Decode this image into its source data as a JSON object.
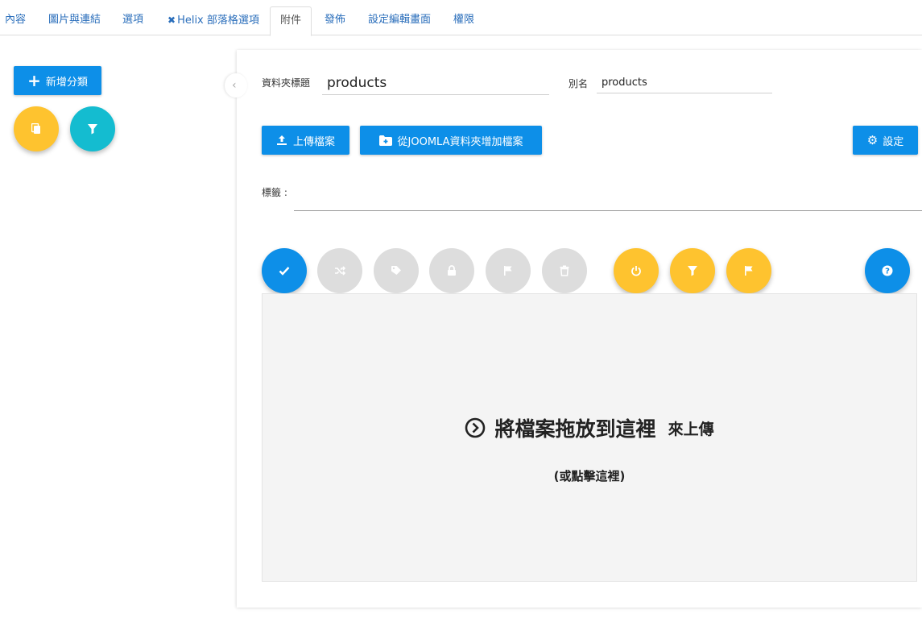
{
  "tabs": [
    {
      "label": "內容"
    },
    {
      "label": "圖片與連結"
    },
    {
      "label": "選項"
    },
    {
      "label": "Helix 部落格選項",
      "icon": "joomla-icon"
    },
    {
      "label": "附件",
      "active": true
    },
    {
      "label": "發佈"
    },
    {
      "label": "設定編輯畫面"
    },
    {
      "label": "權限"
    }
  ],
  "sidebar": {
    "add_category_label": "新增分類",
    "copy_icon": "copy-icon",
    "filter_icon": "filter-icon"
  },
  "folder": {
    "title_label": "資料夾標題",
    "title_value": "products",
    "alias_label": "別名",
    "alias_value": "products"
  },
  "toolbar": {
    "upload_label": "上傳檔案",
    "add_from_joomla_label": "從JOOMLA資料夾增加檔案",
    "settings_label": "設定"
  },
  "tags": {
    "label": "標籤 :"
  },
  "actions": [
    {
      "icon": "check-icon",
      "style": "blue"
    },
    {
      "icon": "shuffle-icon",
      "style": "grey"
    },
    {
      "icon": "tag-icon",
      "style": "grey"
    },
    {
      "icon": "lock-icon",
      "style": "grey"
    },
    {
      "icon": "flag-icon",
      "style": "grey"
    },
    {
      "icon": "trash-icon",
      "style": "grey"
    },
    {
      "icon": "power-icon",
      "style": "yellow"
    },
    {
      "icon": "filter-icon",
      "style": "yellow"
    },
    {
      "icon": "flag-icon",
      "style": "yellow"
    },
    {
      "icon": "help-icon",
      "style": "blue"
    }
  ],
  "dropzone": {
    "main": "將檔案拖放到這裡",
    "suffix": "來上傳",
    "sub": "(或點擊這裡)"
  },
  "colors": {
    "primary": "#0d8fe8",
    "yellow": "#fec32f",
    "teal": "#14bcd0",
    "grey": "#dddddd",
    "link": "#2a6ebb"
  }
}
